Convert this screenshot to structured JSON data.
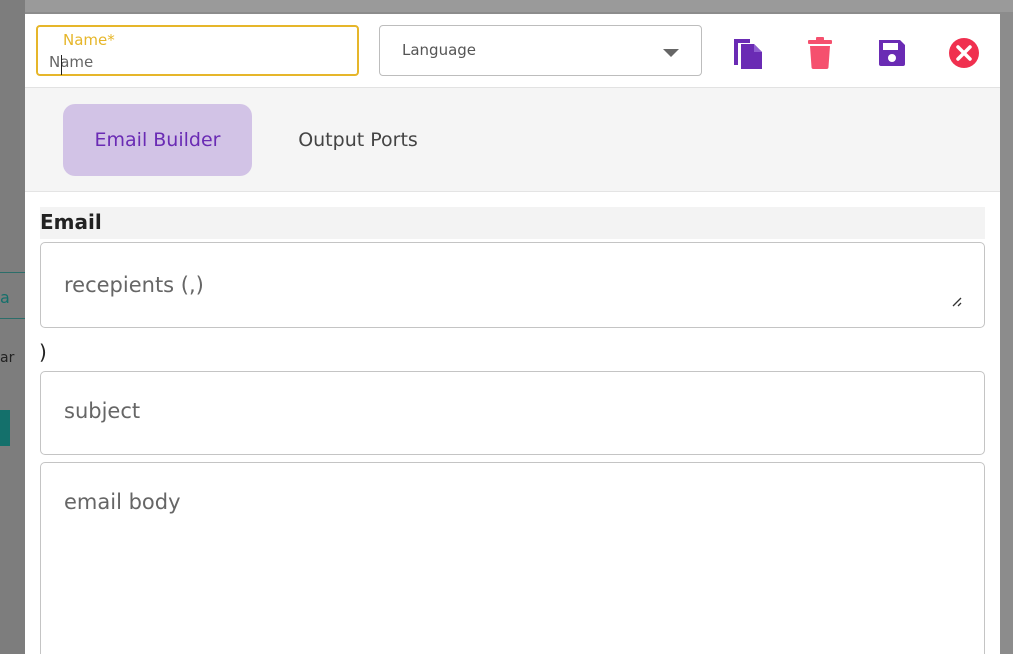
{
  "background": {
    "left_fragment_a": "a",
    "left_fragment_b": "ar"
  },
  "header": {
    "name_label": "Name*",
    "name_placeholder": "Name",
    "language_placeholder": "Language",
    "icons": {
      "copy": "copy-icon",
      "delete": "trash-icon",
      "save": "save-icon",
      "close": "close-icon"
    },
    "colors": {
      "accent_yellow": "#e6b62a",
      "purple": "#6a2bb4",
      "pink": "#f5506e",
      "close_red": "#f0304f"
    }
  },
  "tabs": [
    {
      "label": "Email Builder",
      "active": true
    },
    {
      "label": "Output Ports",
      "active": false
    }
  ],
  "email": {
    "section_title": "Email",
    "recipients_placeholder": "recepients (,)",
    "stray_text": ")",
    "subject_placeholder": "subject",
    "body_placeholder": "email body"
  }
}
